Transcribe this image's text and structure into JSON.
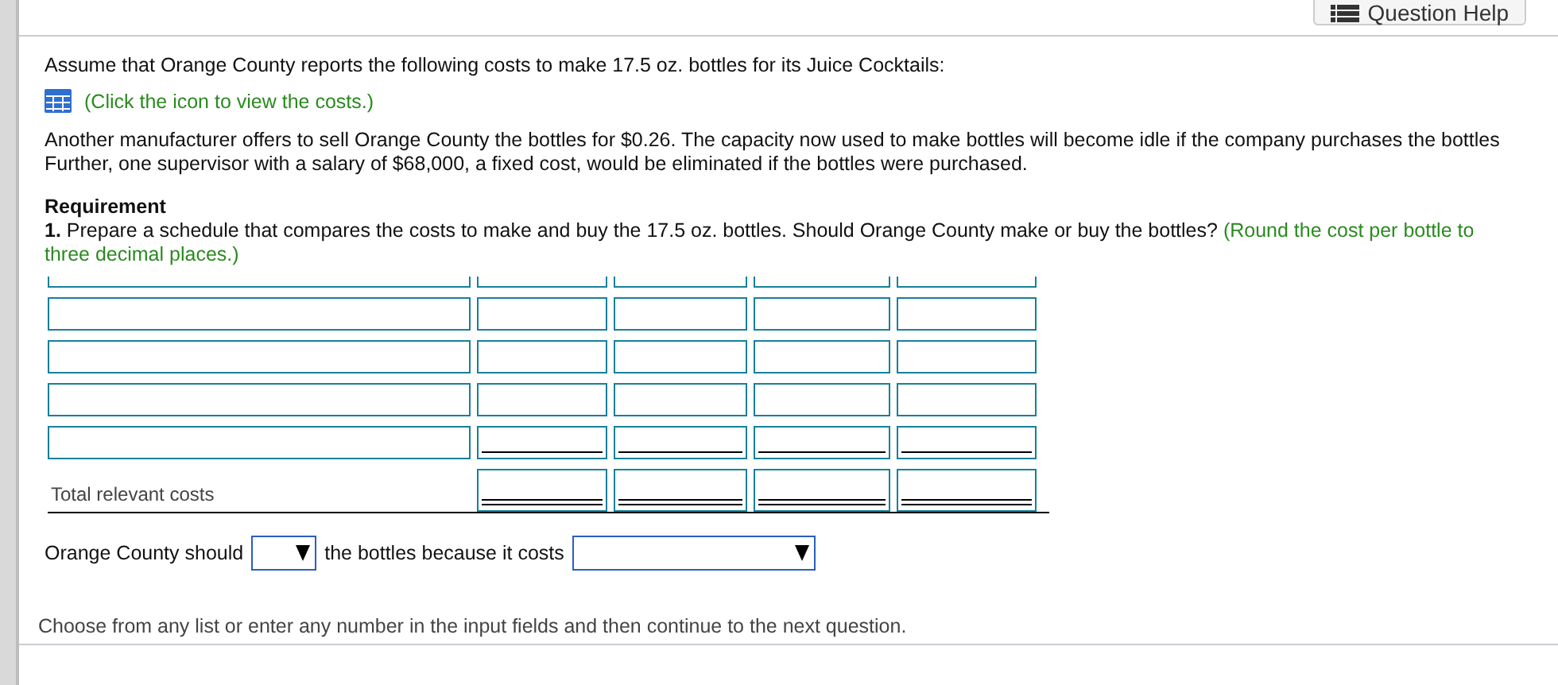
{
  "toolbar": {
    "help_button": "Question Help"
  },
  "intro": "Assume that Orange County reports the following costs to make 17.5 oz. bottles for its Juice Cocktails:",
  "costs_link": "(Click the icon to view the costs.)",
  "paragraph": [
    "Another manufacturer offers to sell Orange County the bottles for $0.26. The capacity now used to make bottles will become idle if the company purchases the bottles",
    "Further, one supervisor with a salary of $68,000, a fixed cost, would be eliminated if the bottles were purchased."
  ],
  "requirement": {
    "heading": "Requirement",
    "text": "**1.** Prepare a schedule that compares the costs to make and buy the 17.5 oz. bottles. Should Orange County make or buy the bottles?",
    "hint": "(Round the cost per bottle to three decimal places.)"
  },
  "table": {
    "rows": [
      {
        "kind": "cut"
      },
      {
        "kind": "entry"
      },
      {
        "kind": "entry"
      },
      {
        "kind": "entry"
      },
      {
        "kind": "subtotal"
      },
      {
        "kind": "total",
        "label": "Total relevant costs"
      }
    ]
  },
  "answer": {
    "before": "Orange County should",
    "middle": "the bottles because it costs"
  },
  "footer": "Choose from any list or enter any number in the input fields and then continue to the next question."
}
